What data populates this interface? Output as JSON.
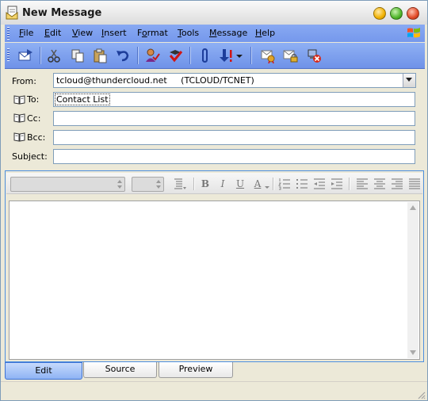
{
  "window": {
    "title": "New Message"
  },
  "menu": [
    {
      "label": "File",
      "mnemonic": "F",
      "rest": "ile"
    },
    {
      "label": "Edit",
      "mnemonic": "E",
      "rest": "dit"
    },
    {
      "label": "View",
      "mnemonic": "V",
      "rest": "iew"
    },
    {
      "label": "Insert",
      "mnemonic": "I",
      "rest": "nsert"
    },
    {
      "label": "Format",
      "mnemonic": "o",
      "pre": "F",
      "rest": "rmat"
    },
    {
      "label": "Tools",
      "mnemonic": "T",
      "rest": "ools"
    },
    {
      "label": "Message",
      "mnemonic": "M",
      "rest": "essage"
    },
    {
      "label": "Help",
      "mnemonic": "H",
      "rest": "elp"
    }
  ],
  "toolbar_icons": [
    "send-icon",
    "cut-icon",
    "copy-icon",
    "paste-icon",
    "undo-icon",
    "check-names-icon",
    "spelling-icon",
    "attach-icon",
    "priority-icon",
    "dropdown-arrow-icon",
    "sign-icon",
    "encrypt-icon",
    "offline-icon"
  ],
  "header": {
    "from_label": "From:",
    "from_value": "tcloud@thundercloud.net     (TCLOUD/TCNET)",
    "to_label": "To:",
    "to_value": "Contact List",
    "cc_label": "Cc:",
    "cc_value": "",
    "bcc_label": "Bcc:",
    "bcc_value": "",
    "subject_label": "Subject:",
    "subject_value": ""
  },
  "format_bar": {
    "font_name": "",
    "font_size": "",
    "bold": "B",
    "italic": "I",
    "underline": "U",
    "font_color": "A"
  },
  "body": {
    "text": ""
  },
  "tabs": [
    {
      "label": "Edit",
      "active": true
    },
    {
      "label": "Source",
      "active": false
    },
    {
      "label": "Preview",
      "active": false
    }
  ],
  "colors": {
    "menubar": "#7f9ff0",
    "toolbar": "#7f9ff0",
    "active_tab": "#8fb3f4",
    "window_bg": "#ece9d8"
  }
}
